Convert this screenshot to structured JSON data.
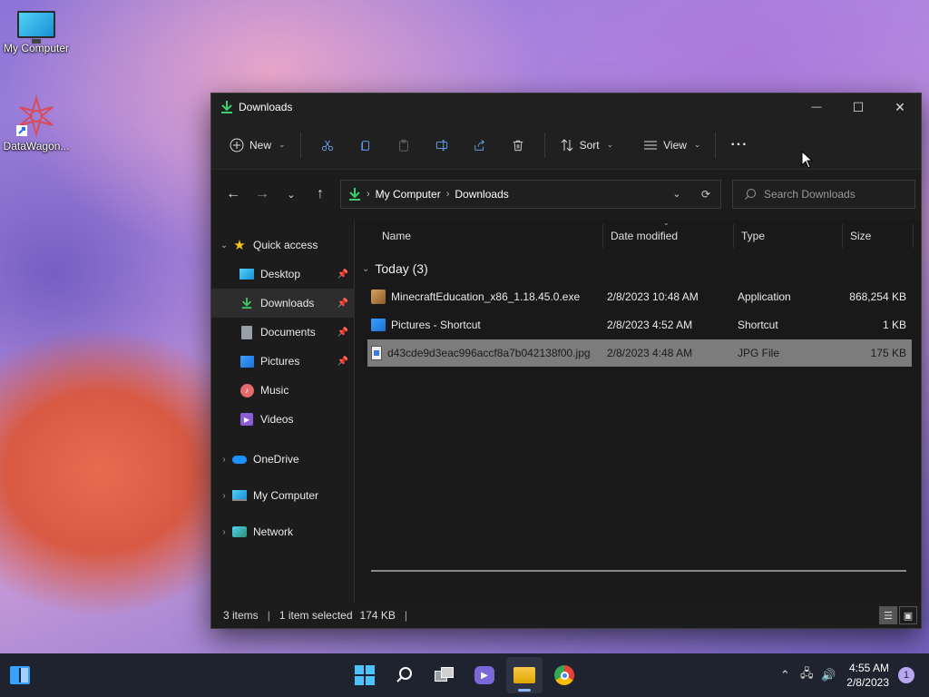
{
  "desktop": {
    "icons": [
      {
        "label": "My Computer",
        "icon": "monitor-icon"
      },
      {
        "label": "DataWagon...",
        "icon": "datawagon-icon"
      }
    ]
  },
  "window": {
    "title": "Downloads",
    "controls": {
      "minimize": "—",
      "maximize": "☐",
      "close": "✕"
    }
  },
  "toolbar": {
    "new_label": "New",
    "sort_label": "Sort",
    "view_label": "View",
    "more_label": "···"
  },
  "address": {
    "crumbs": [
      "My Computer",
      "Downloads"
    ],
    "search_placeholder": "Search Downloads"
  },
  "sidebar": {
    "quick_access": "Quick access",
    "items": [
      {
        "label": "Desktop",
        "pinned": true
      },
      {
        "label": "Downloads",
        "pinned": true
      },
      {
        "label": "Documents",
        "pinned": true
      },
      {
        "label": "Pictures",
        "pinned": true
      },
      {
        "label": "Music",
        "pinned": false
      },
      {
        "label": "Videos",
        "pinned": false
      }
    ],
    "roots": [
      "OneDrive",
      "My Computer",
      "Network"
    ]
  },
  "columns": {
    "name": "Name",
    "date": "Date modified",
    "type": "Type",
    "size": "Size"
  },
  "group": {
    "label": "Today (3)"
  },
  "files": [
    {
      "name": "MinecraftEducation_x86_1.18.45.0.exe",
      "date": "2/8/2023 10:48 AM",
      "type": "Application",
      "size": "868,254 KB"
    },
    {
      "name": "Pictures - Shortcut",
      "date": "2/8/2023 4:52 AM",
      "type": "Shortcut",
      "size": "1 KB"
    },
    {
      "name": "d43cde9d3eac996accf8a7b042138f00.jpg",
      "date": "2/8/2023 4:48 AM",
      "type": "JPG File",
      "size": "175 KB"
    }
  ],
  "status": {
    "items": "3 items",
    "selected": "1 item selected",
    "selected_size": "174 KB"
  },
  "taskbar": {
    "time": "4:55 AM",
    "date": "2/8/2023",
    "notifications": "1"
  }
}
